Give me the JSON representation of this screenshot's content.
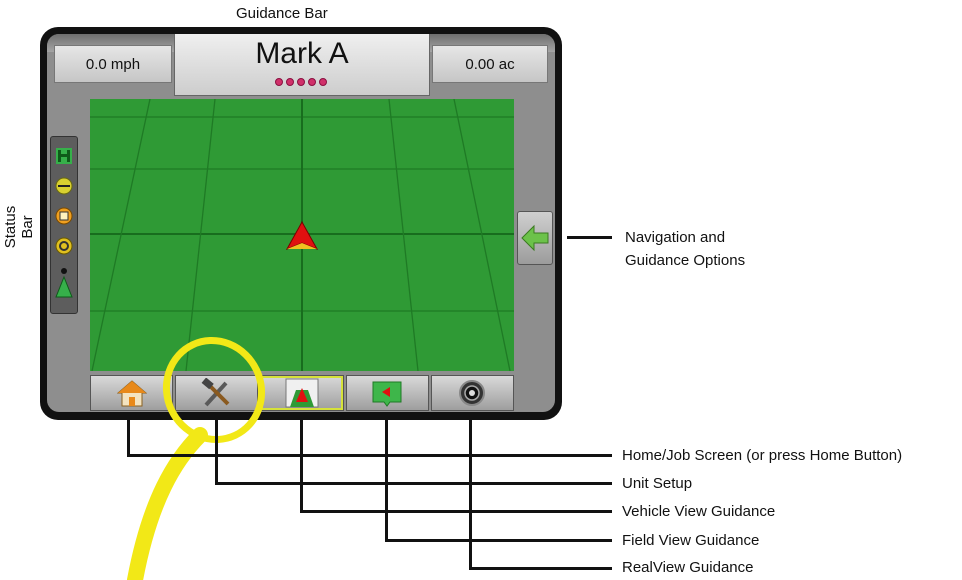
{
  "callouts": {
    "guidance_bar": "Guidance Bar",
    "status_bar": "Status Bar",
    "nav_options_line1": "Navigation and",
    "nav_options_line2": "Guidance Options",
    "home_job": "Home/Job Screen (or press Home Button)",
    "unit_setup": "Unit Setup",
    "vehicle_view": "Vehicle View Guidance",
    "field_view": "Field View Guidance",
    "realview": "RealView Guidance"
  },
  "screen": {
    "speed": "0.0 mph",
    "mark_title": "Mark A",
    "area": "0.00 ac",
    "gps_dots": 5
  },
  "status_icons": [
    "implement-status-icon",
    "boom-section-icon",
    "tilt-module-icon",
    "steering-icon",
    "gps-status-icon"
  ],
  "bottom_buttons": [
    "home-icon",
    "unit-setup-icon",
    "vehicle-view-icon",
    "field-view-icon",
    "realview-icon"
  ],
  "colors": {
    "field_green": "#2f9a35",
    "highlight_yellow": "#f2e817",
    "vehicle_red": "#e01010",
    "nav_arrow_green": "#6cc24a"
  }
}
